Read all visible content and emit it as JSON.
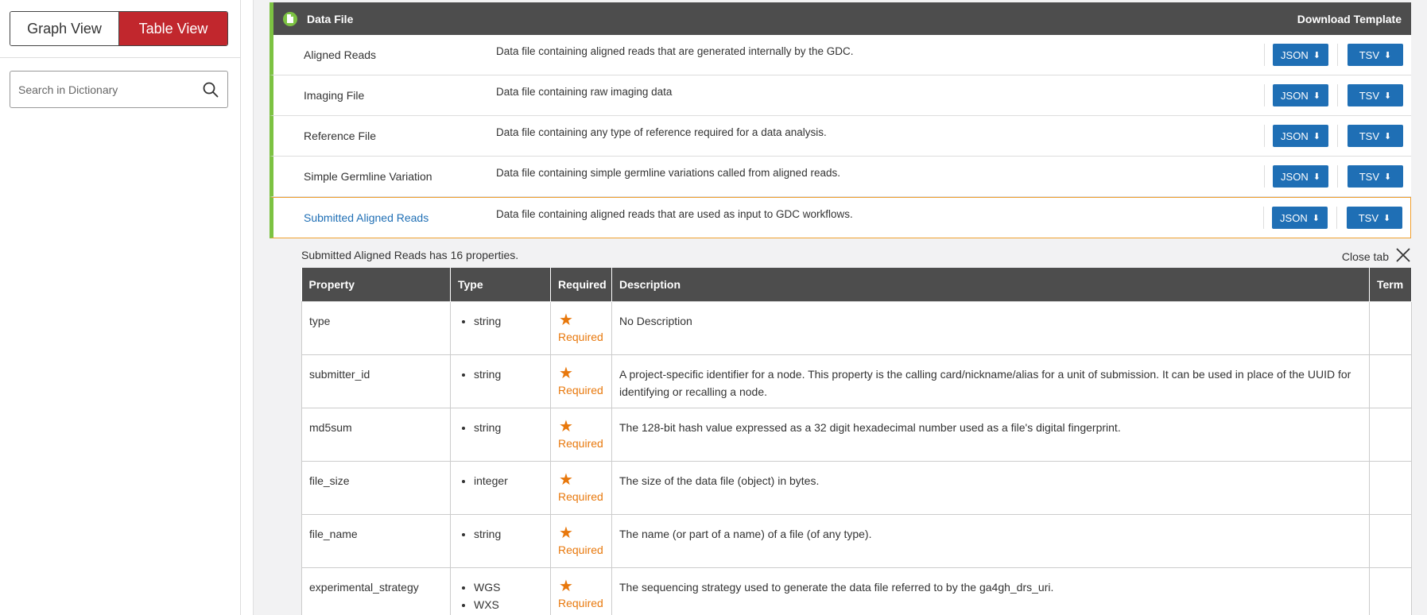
{
  "sidebar": {
    "graph_view_label": "Graph View",
    "table_view_label": "Table View",
    "search_placeholder": "Search in Dictionary"
  },
  "category": {
    "title": "Data File",
    "download_template": "Download Template",
    "accent_color": "#7cc242"
  },
  "nodes": [
    {
      "name": "Aligned Reads",
      "description": "Data file containing aligned reads that are generated internally by the GDC.",
      "json": "JSON",
      "tsv": "TSV"
    },
    {
      "name": "Imaging File",
      "description": "Data file containing raw imaging data",
      "json": "JSON",
      "tsv": "TSV"
    },
    {
      "name": "Reference File",
      "description": "Data file containing any type of reference required for a data analysis.",
      "json": "JSON",
      "tsv": "TSV"
    },
    {
      "name": "Simple Germline Variation",
      "description": "Data file containing simple germline variations called from aligned reads.",
      "json": "JSON",
      "tsv": "TSV"
    },
    {
      "name": "Submitted Aligned Reads",
      "description": "Data file containing aligned reads that are used as input to GDC workflows.",
      "json": "JSON",
      "tsv": "TSV"
    }
  ],
  "properties_panel": {
    "summary": "Submitted Aligned Reads has 16 properties.",
    "close_label": "Close tab",
    "headers": [
      "Property",
      "Type",
      "Required",
      "Description",
      "Term"
    ],
    "required_label": "Required",
    "rows": [
      {
        "property": "type",
        "types": [
          "string"
        ],
        "description": "No Description"
      },
      {
        "property": "submitter_id",
        "types": [
          "string"
        ],
        "description": "A project-specific identifier for a node. This property is the calling card/nickname/alias for a unit of submission. It can be used in place of the UUID for identifying or recalling a node."
      },
      {
        "property": "md5sum",
        "types": [
          "string"
        ],
        "description": "The 128-bit hash value expressed as a 32 digit hexadecimal number used as a file's digital fingerprint."
      },
      {
        "property": "file_size",
        "types": [
          "integer"
        ],
        "description": "The size of the data file (object) in bytes."
      },
      {
        "property": "file_name",
        "types": [
          "string"
        ],
        "description": "The name (or part of a name) of a file (of any type)."
      },
      {
        "property": "experimental_strategy",
        "types": [
          "WGS",
          "WXS"
        ],
        "description": "The sequencing strategy used to generate the data file referred to by the ga4gh_drs_uri."
      }
    ]
  },
  "colors": {
    "table_view_active": "#c1272d",
    "button_blue": "#1f6fb5",
    "required_orange": "#e8780c",
    "header_gray": "#4d4d4d"
  }
}
